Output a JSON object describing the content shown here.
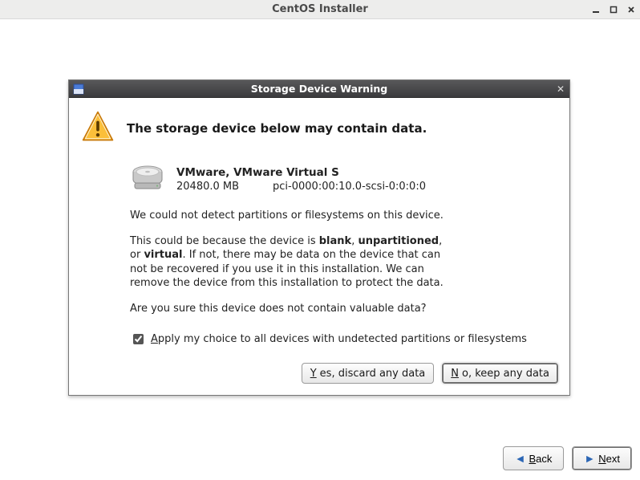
{
  "window": {
    "title": "CentOS Installer"
  },
  "dialog": {
    "title": "Storage Device Warning",
    "heading": "The storage device below may contain data.",
    "device": {
      "name": "VMware, VMware Virtual S",
      "size": "20480.0 MB",
      "path": "pci-0000:00:10.0-scsi-0:0:0:0"
    },
    "para1": "We could not detect partitions or filesystems on this device.",
    "para2_pre": "This could be because the device is ",
    "para2_b1": "blank",
    "para2_sep1": ", ",
    "para2_b2": "unpartitioned",
    "para2_sep2": ", or ",
    "para2_b3": "virtual",
    "para2_post": ". If not, there may be data on the device that can not be recovered if you use it in this installation. We can remove the device from this installation to protect the data.",
    "para3": "Are you sure this device does not contain valuable data?",
    "checkbox": {
      "checked": true,
      "mnemonic": "A",
      "label_rest": "pply my choice to all devices with undetected partitions or filesystems"
    },
    "buttons": {
      "discard_mnemonic": "Y",
      "discard_rest": "es, discard any data",
      "keep_mnemonic": "N",
      "keep_rest": "o, keep any data"
    }
  },
  "nav": {
    "back_mnemonic": "B",
    "back_rest": "ack",
    "next_mnemonic": "N",
    "next_rest": "ext"
  }
}
